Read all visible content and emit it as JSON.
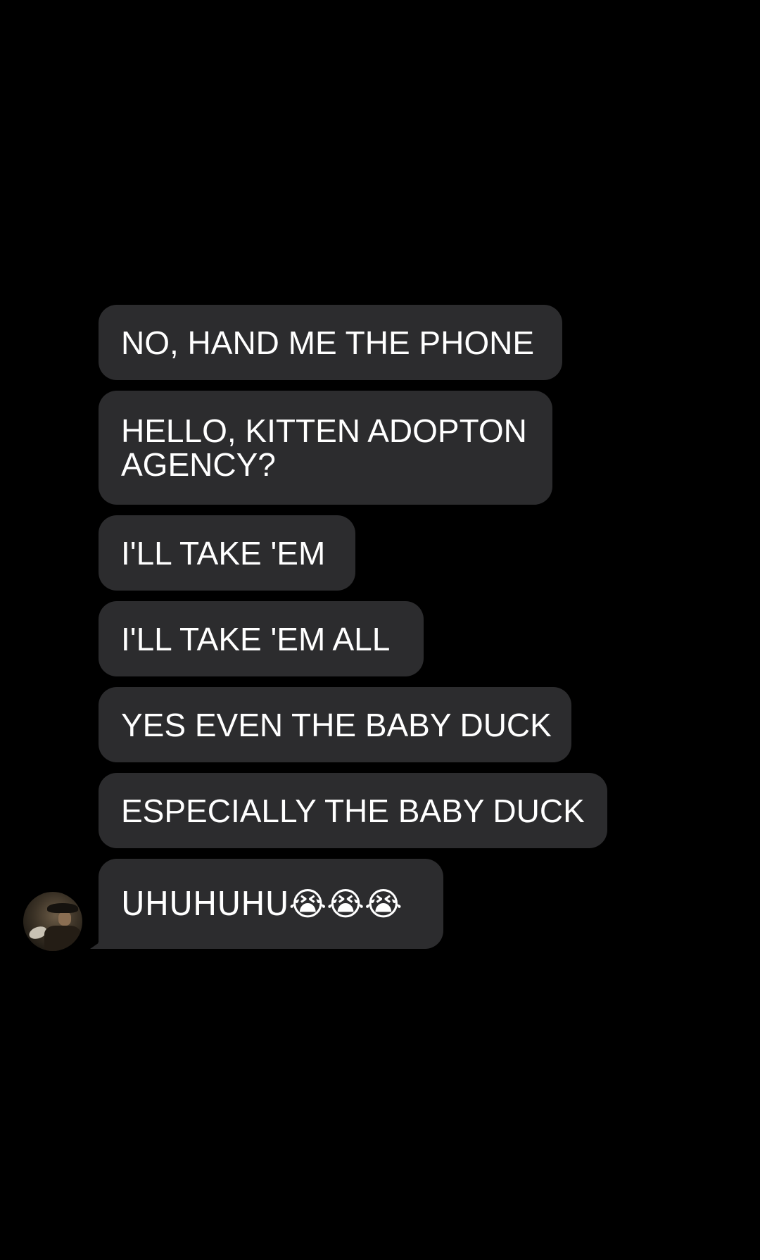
{
  "messages": [
    {
      "text": "NO, HAND ME THE PHONE"
    },
    {
      "text": "HELLO, KITTEN ADOPTON AGENCY?"
    },
    {
      "text": "I'LL TAKE 'EM"
    },
    {
      "text": "I'LL TAKE 'EM ALL"
    },
    {
      "text": "YES EVEN THE BABY DUCK"
    },
    {
      "text": "ESPECIALLY THE BABY DUCK"
    },
    {
      "text": "UHUHUHU😭😭😭"
    }
  ],
  "colors": {
    "background": "#000000",
    "bubble": "#2c2c2e",
    "text": "#ffffff"
  },
  "avatar": {
    "icon": "profile-photo-avatar"
  }
}
